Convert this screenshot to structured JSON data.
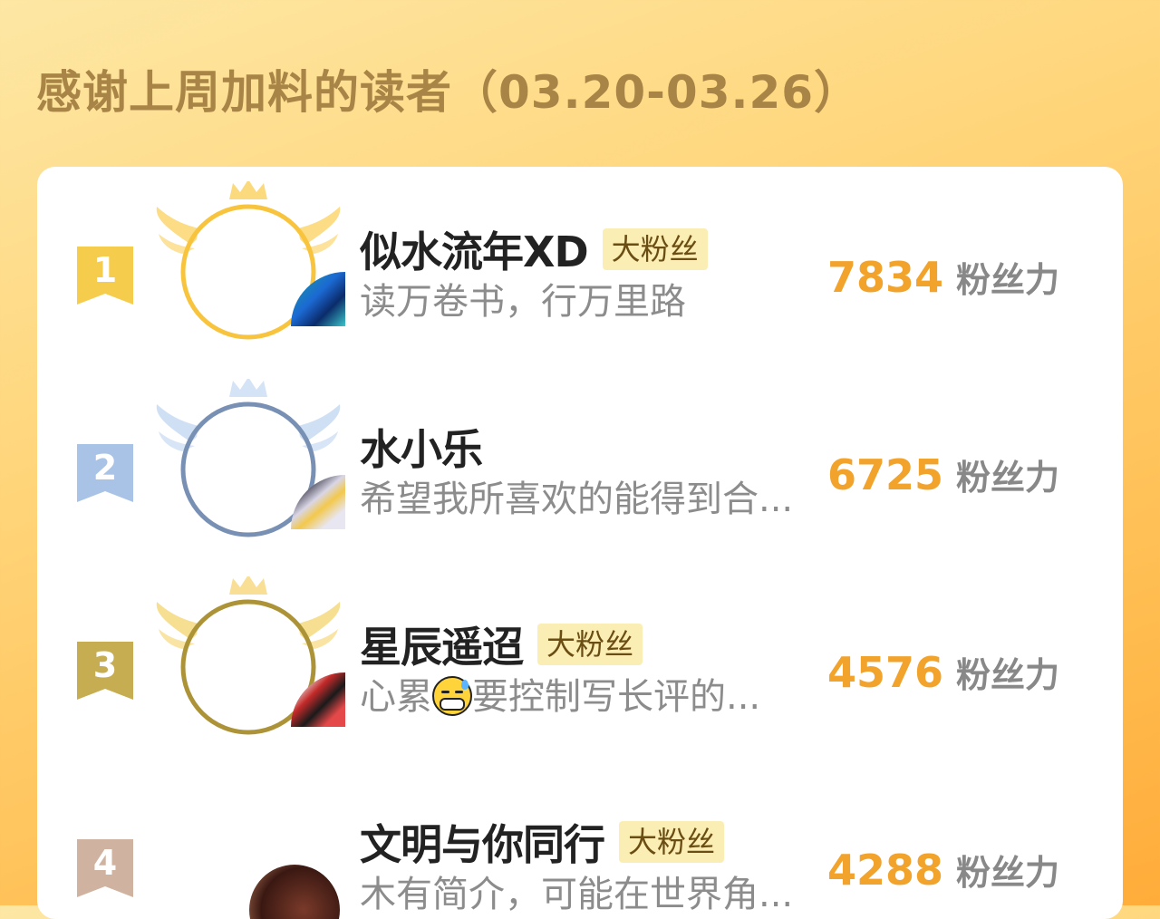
{
  "header": {
    "title": "感谢上周加料的读者（03.20-03.26）"
  },
  "colors": {
    "rank1": "#f6cc4c",
    "rank2": "#a9c3e6",
    "rank3": "#c6ad52",
    "rank4": "#cfb3a0",
    "score": "#f2a32c",
    "badge_bg": "#fbeeb4"
  },
  "readers": [
    {
      "rank": "1",
      "name": "似水流年XD",
      "badge": "大粉丝",
      "bio": "读万卷书，行万里路",
      "score": "7834",
      "unit": "粉丝力"
    },
    {
      "rank": "2",
      "name": "水小乐",
      "badge": "",
      "bio": "希望我所喜欢的能得到合...",
      "score": "6725",
      "unit": "粉丝力"
    },
    {
      "rank": "3",
      "name": "星辰遥迢",
      "badge": "大粉丝",
      "bio_before": "心累",
      "bio_emoji": "sweat-mask-emoji",
      "bio_after": "要控制写长评的...",
      "score": "4576",
      "unit": "粉丝力"
    },
    {
      "rank": "4",
      "name": "文明与你同行",
      "badge": "大粉丝",
      "bio": "木有简介，可能在世界角...",
      "score": "4288",
      "unit": "粉丝力"
    }
  ]
}
